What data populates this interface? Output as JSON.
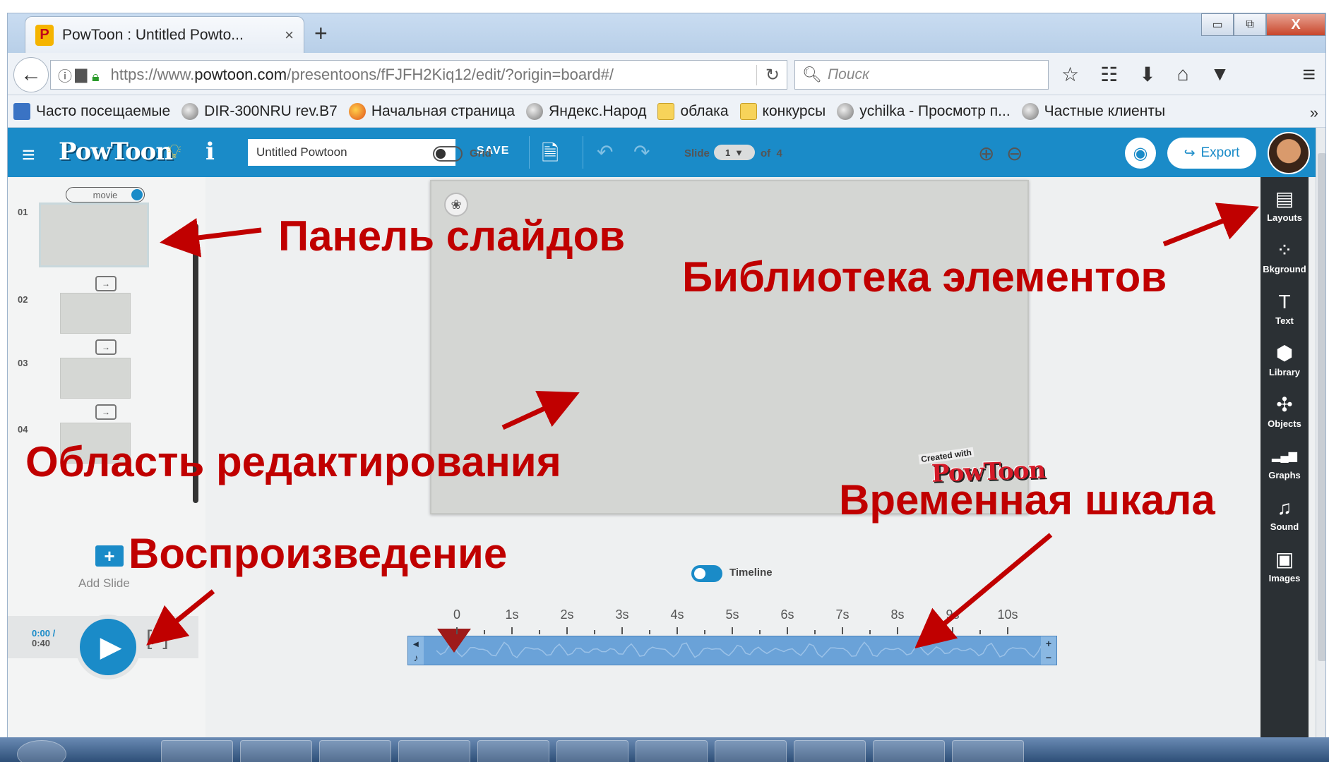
{
  "browser": {
    "tab_title": "PowToon : Untitled Powto...",
    "tab_close": "×",
    "new_tab": "+",
    "window_controls": {
      "minimize": "▭",
      "maximize": "⧉",
      "close": "X"
    },
    "url_prefix": "https://www.",
    "url_domain": "powtoon.com",
    "url_path": "/presentoons/fFJFH2Kiq12/edit/?origin=board#/",
    "search_placeholder": "Поиск",
    "bookmarks": [
      {
        "label": "Часто посещаемые",
        "icon": "page"
      },
      {
        "label": "DIR-300NRU rev.B7",
        "icon": "globe"
      },
      {
        "label": "Начальная страница",
        "icon": "fox"
      },
      {
        "label": "Яндекс.Народ",
        "icon": "globe"
      },
      {
        "label": "облака",
        "icon": "folder"
      },
      {
        "label": "конкурсы",
        "icon": "folder"
      },
      {
        "label": "ychilka - Просмотр п...",
        "icon": "globe"
      },
      {
        "label": "Частные клиенты",
        "icon": "globe"
      }
    ],
    "bookmarks_more": "»"
  },
  "app": {
    "logo": "PowToon",
    "title_value": "Untitled Powtoon",
    "save_label": "SAVE",
    "export_label": "Export",
    "movie_label": "movie",
    "slides": [
      "01",
      "02",
      "03",
      "04"
    ],
    "add_slide_label": "Add Slide",
    "time_current": "0:00 /",
    "time_total": "0:40",
    "grid_label": "Grid",
    "slide_label": "Slide",
    "slide_current": "1",
    "slide_of": "of",
    "slide_total": "4",
    "timeline_label": "Timeline",
    "watermark": "PowToon",
    "watermark_small": "Created with",
    "timeline_ticks": [
      "0",
      "1s",
      "2s",
      "3s",
      "4s",
      "5s",
      "6s",
      "7s",
      "8s",
      "9s",
      "10s"
    ],
    "tools": [
      {
        "label": "Layouts",
        "icon": "layouts-icon",
        "glyph": "▤"
      },
      {
        "label": "Bkground",
        "icon": "background-icon",
        "glyph": "⁘"
      },
      {
        "label": "Text",
        "icon": "text-icon",
        "glyph": "T"
      },
      {
        "label": "Library",
        "icon": "library-icon",
        "glyph": "⬢"
      },
      {
        "label": "Objects",
        "icon": "objects-icon",
        "glyph": "✣"
      },
      {
        "label": "Graphs",
        "icon": "graphs-icon",
        "glyph": "▂▄▆"
      },
      {
        "label": "Sound",
        "icon": "sound-icon",
        "glyph": "♫"
      },
      {
        "label": "Images",
        "icon": "images-icon",
        "glyph": "▣"
      }
    ],
    "accent_color": "#1a8bc8"
  },
  "annotations": {
    "slides_panel": "Панель слайдов",
    "library": "Библиотека элементов",
    "edit_area": "Область редактирования",
    "timeline": "Временная шкала",
    "playback": "Воспроизведение",
    "color": "#c00000"
  }
}
